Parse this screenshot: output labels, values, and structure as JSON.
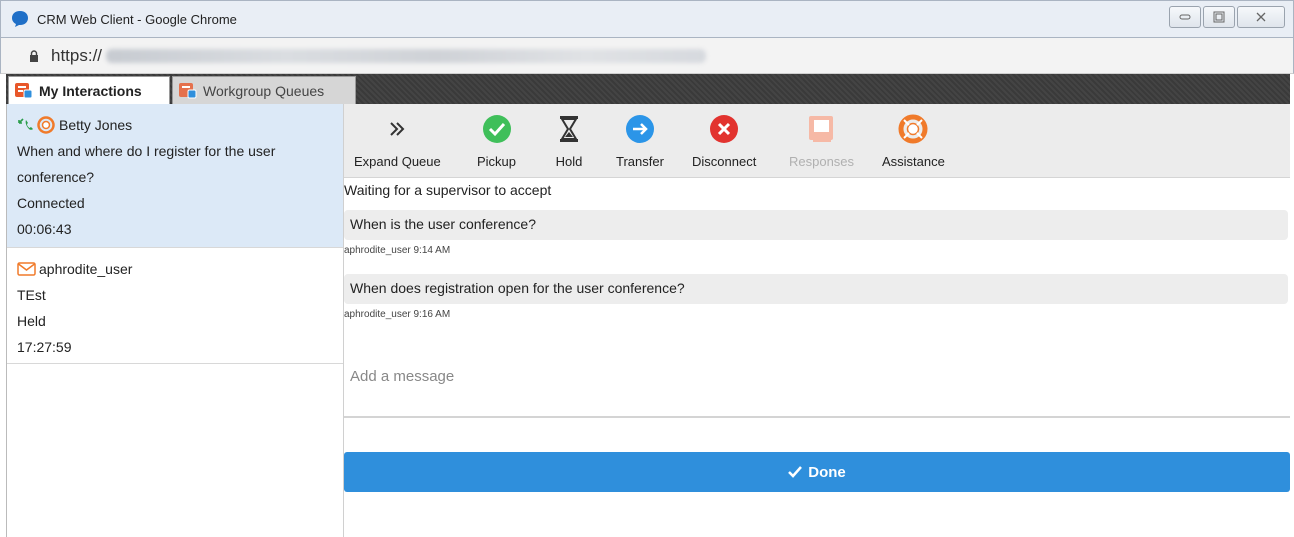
{
  "window": {
    "title": "CRM Web Client - Google Chrome",
    "url_prefix": "https://"
  },
  "tabs": [
    {
      "label": "My Interactions"
    },
    {
      "label": "Workgroup Queues"
    }
  ],
  "interactions": [
    {
      "name": "Betty Jones",
      "subject_line1": "When and where do I register for the user",
      "subject_line2": "conference?",
      "status": "Connected",
      "time": "00:06:43"
    },
    {
      "name": "aphrodite_user",
      "subject_line1": "TEst",
      "status": "Held",
      "time": "17:27:59"
    }
  ],
  "toolbar": {
    "expand_queue": "Expand Queue",
    "pickup": "Pickup",
    "hold": "Hold",
    "transfer": "Transfer",
    "disconnect": "Disconnect",
    "responses": "Responses",
    "assistance": "Assistance"
  },
  "chat": {
    "waiting": "Waiting for a supervisor to accept",
    "messages": [
      {
        "text": "When is the user conference?",
        "meta": "aphrodite_user 9:14 AM"
      },
      {
        "text": "When does registration open for the user conference?",
        "meta": "aphrodite_user 9:16 AM"
      }
    ],
    "compose_placeholder": "Add a message",
    "done_label": "Done"
  },
  "colors": {
    "accent": "#2f8fdc",
    "selected_row": "#dce9f7",
    "pickup_green": "#3fbf5a",
    "disconnect_red": "#e2332f",
    "assistance_orange": "#f07a2a"
  }
}
